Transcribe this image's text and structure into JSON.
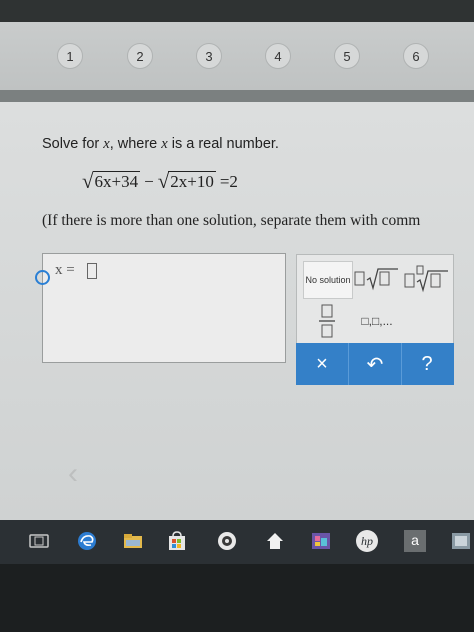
{
  "steps": [
    "1",
    "2",
    "3",
    "4",
    "5",
    "6"
  ],
  "problem": {
    "prompt_a": "Solve for ",
    "var1": "x",
    "prompt_b": ", where ",
    "var2": "x",
    "prompt_c": " is a real number.",
    "rad1": "6x+34",
    "minus": "−",
    "rad2": "2x+10",
    "equals": "=2",
    "note": "(If there is more than one solution, separate them with comm"
  },
  "answer": {
    "label": "x ="
  },
  "keypad": {
    "no_solution": "No solution",
    "list_label": "□,□,..."
  },
  "actions": {
    "clear": "×",
    "undo": "↶",
    "help": "?"
  },
  "icons": {
    "clear": "close-icon",
    "undo": "undo-icon",
    "help": "help-icon",
    "back": "chevron-left-icon"
  },
  "taskbar": {
    "hp_label": "hp",
    "amazon_label": "a"
  },
  "colors": {
    "action_bar": "#3480c8",
    "cursor": "#2a7fd4"
  }
}
